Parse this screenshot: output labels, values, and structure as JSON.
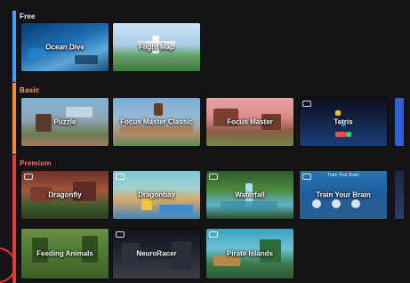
{
  "categories": [
    {
      "id": "free",
      "label": "Free",
      "color": "#3aa0ff"
    },
    {
      "id": "basic",
      "label": "Basic",
      "color": "#f28c28"
    },
    {
      "id": "premium",
      "label": "Premium",
      "color": "#e53935"
    }
  ],
  "free_games": [
    {
      "title": "Ocean Dive"
    },
    {
      "title": "Flight Map"
    }
  ],
  "basic_games": [
    {
      "title": "Puzzle"
    },
    {
      "title": "Focus Master Classic"
    },
    {
      "title": "Focus Master"
    },
    {
      "title": "Tetris",
      "controller_icon": "gamepad-icon"
    }
  ],
  "premium_games_row1": [
    {
      "title": "Dragonfly",
      "controller_icon": "gamepad-icon"
    },
    {
      "title": "Dragonbay",
      "controller_icon": "gamepad-icon"
    },
    {
      "title": "Waterfall",
      "controller_icon": "gamepad-icon"
    },
    {
      "title": "Train Your Brain",
      "header": "Train Your Brain",
      "controller_icon": "gamepad-icon"
    }
  ],
  "premium_games_row2": [
    {
      "title": "Feeding Animals"
    },
    {
      "title": "NeuroRacer",
      "controller_icon": "gamepad-icon"
    },
    {
      "title": "Pirate Islands",
      "controller_icon": "gamepad-icon"
    }
  ]
}
